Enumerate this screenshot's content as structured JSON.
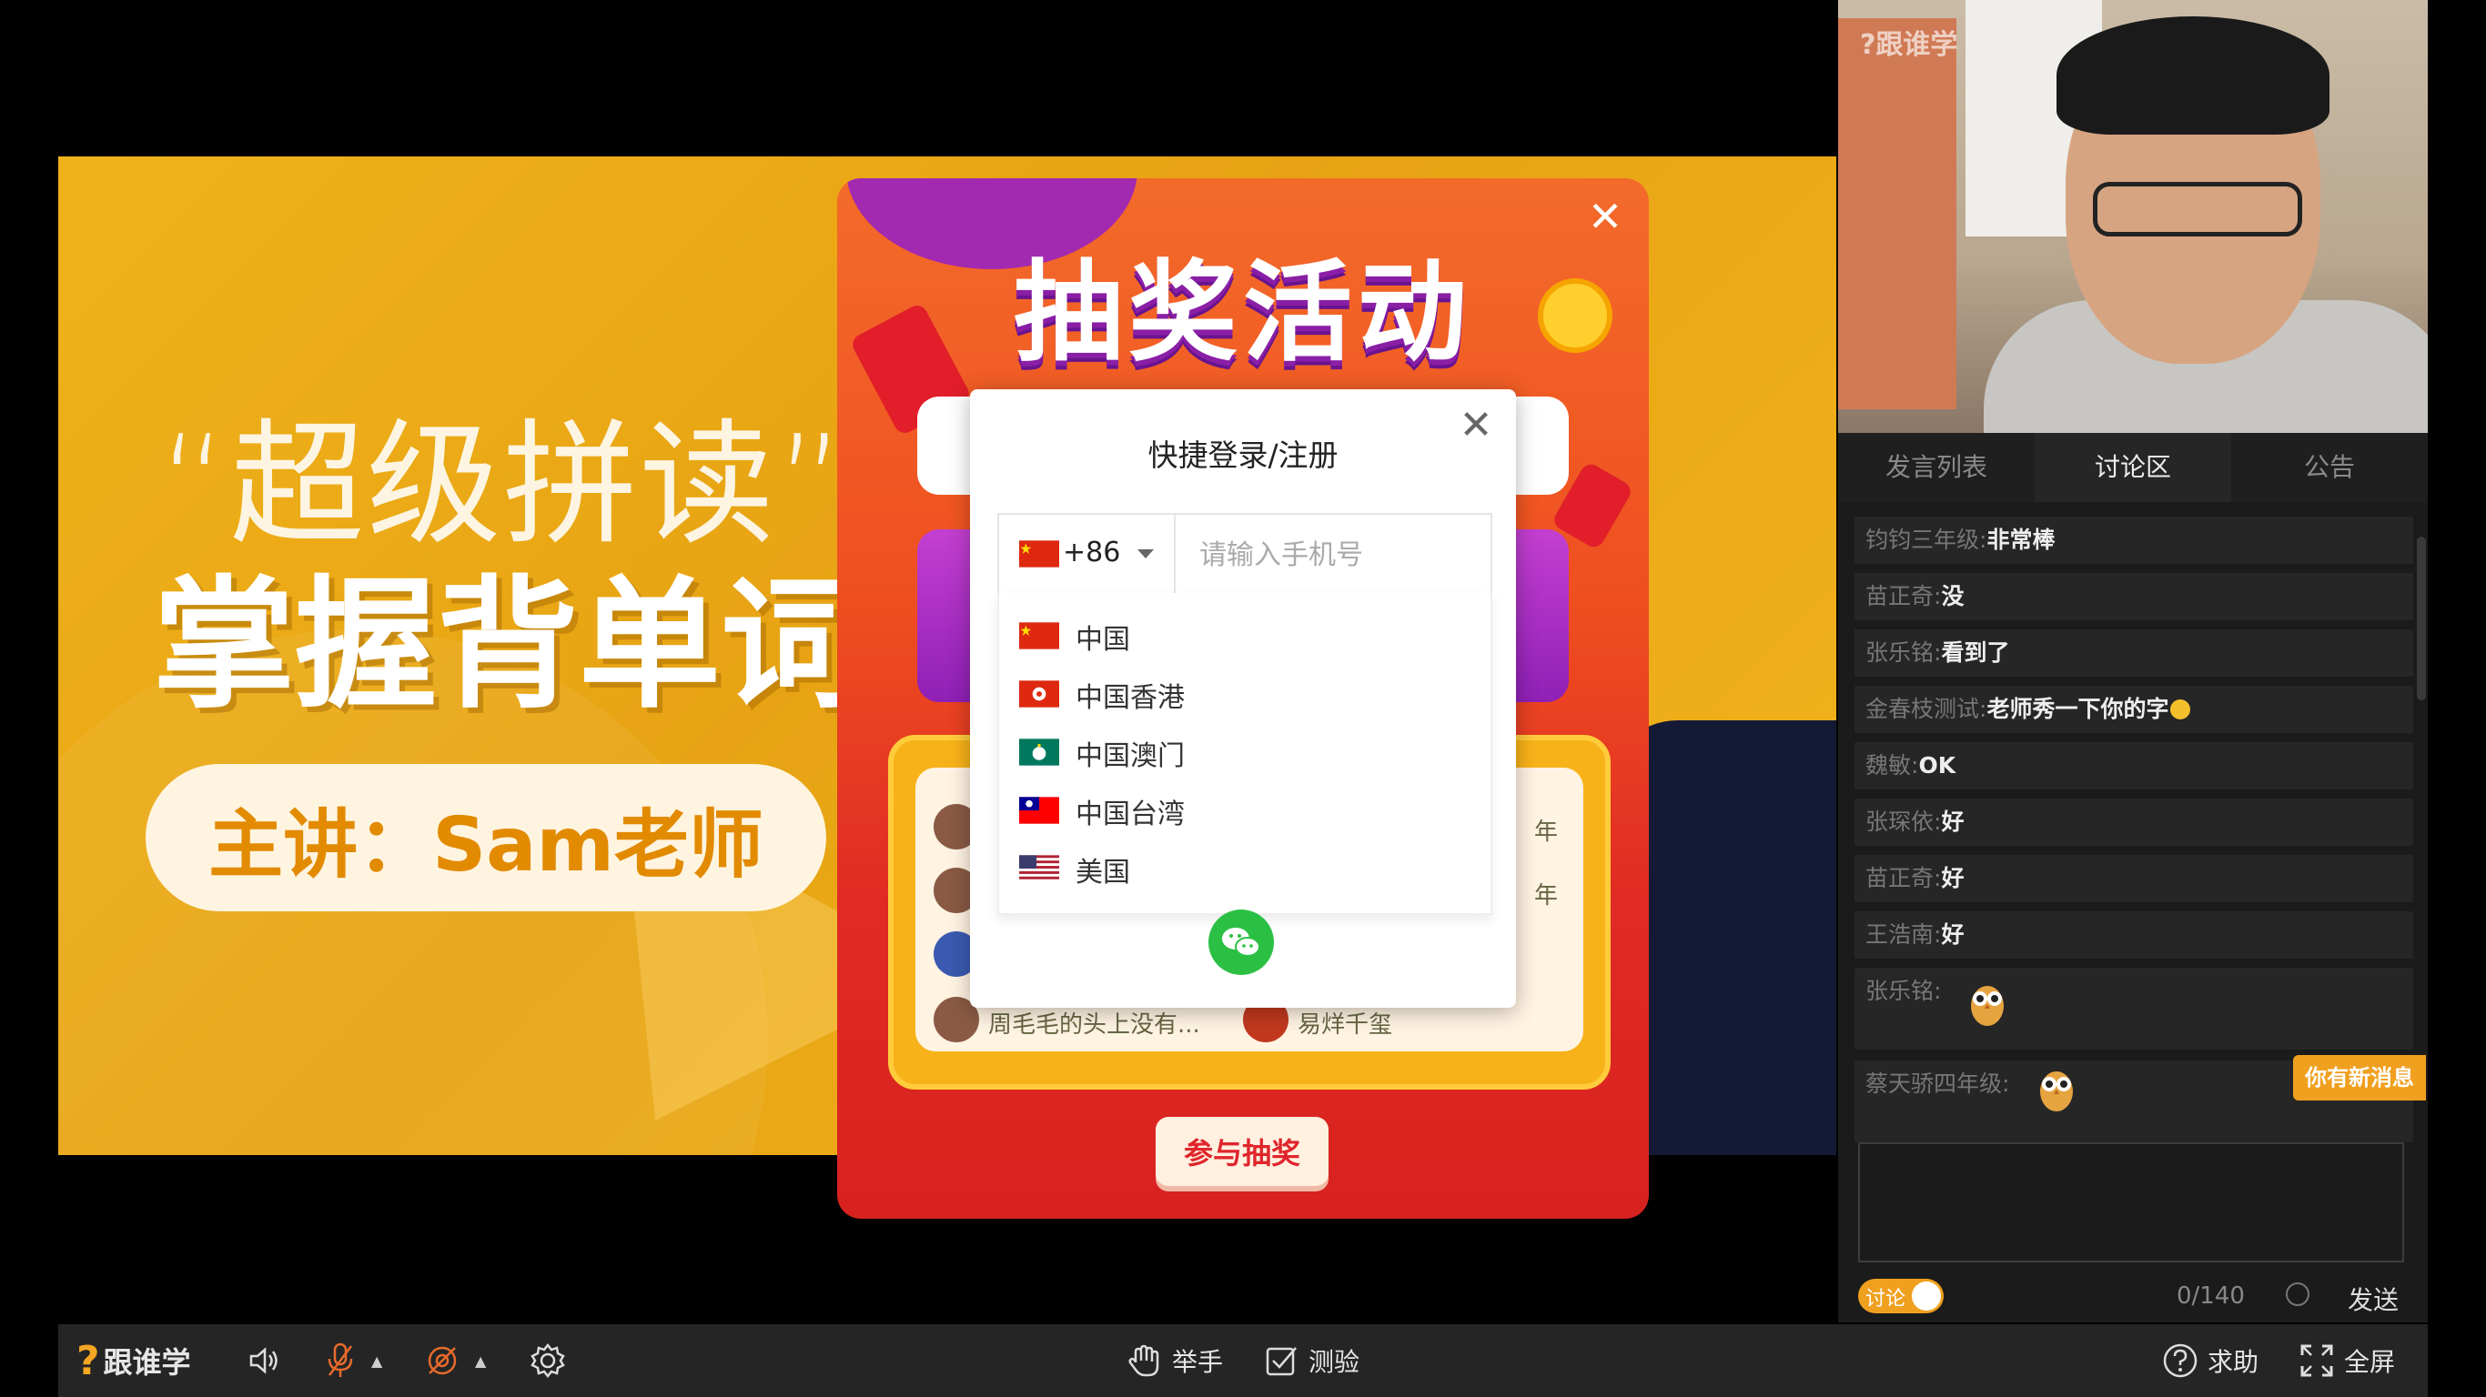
{
  "slide": {
    "subtitle": "“超级拼读”",
    "main": "掌握背单词",
    "presenter": "主讲：Sam老师"
  },
  "lottery": {
    "title": "抽奖活动",
    "rows": [
      {
        "left": "周毛毛的头上没有...",
        "right": "易烊千玺"
      }
    ],
    "right_fragments": [
      "年",
      "年"
    ],
    "join_label": "参与抽奖",
    "close_icon": "close-icon"
  },
  "login": {
    "title": "快捷登录/注册",
    "country_code": "+86",
    "phone_placeholder": "请输入手机号",
    "countries": [
      {
        "flag": "cn",
        "name": "中国"
      },
      {
        "flag": "hk",
        "name": "中国香港"
      },
      {
        "flag": "mo",
        "name": "中国澳门"
      },
      {
        "flag": "tw",
        "name": "中国台湾"
      },
      {
        "flag": "us",
        "name": "美国"
      }
    ],
    "wechat_icon": "wechat-icon"
  },
  "video": {
    "watermark": "?跟谁学"
  },
  "panel": {
    "tabs": [
      "发言列表",
      "讨论区",
      "公告"
    ],
    "active_tab": 1,
    "messages": [
      {
        "user": "钧钧三年级:",
        "text": "非常棒"
      },
      {
        "user": "苗正奇:",
        "text": "没"
      },
      {
        "user": "张乐铭:",
        "text": "看到了"
      },
      {
        "user": "金春枝测试:",
        "text": "老师秀一下你的字",
        "emoji": true
      },
      {
        "user": "魏敏:",
        "text": "OK"
      },
      {
        "user": "张琛依:",
        "text": "好"
      },
      {
        "user": "苗正奇:",
        "text": "好"
      },
      {
        "user": "王浩南:",
        "text": "好"
      },
      {
        "user": "张乐铭:",
        "text": "",
        "sticker": "owl-sticker"
      },
      {
        "user": "蔡天骄四年级:",
        "text": "",
        "sticker": "owl-sticker"
      }
    ],
    "new_message_badge": "你有新消息",
    "toggle_label": "讨论",
    "counter": "0/140",
    "send_label": "发送"
  },
  "toolbar": {
    "brand": "跟谁学",
    "brand_icon": "?",
    "raise_hand": "举手",
    "quiz": "测验",
    "help": "求助",
    "fullscreen": "全屏"
  },
  "colors": {
    "accent": "#f0a01f",
    "lottery_red": "#e02a24",
    "wechat_green": "#2bc044"
  }
}
